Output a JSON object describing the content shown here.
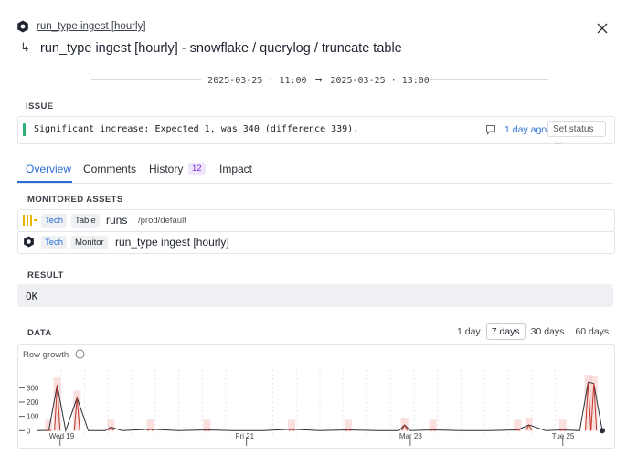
{
  "header": {
    "breadcrumb_link": "run_type ingest [hourly]",
    "subtitle": "run_type ingest [hourly] - snowflake / querylog / truncate table",
    "sub_arrow": "↳"
  },
  "time_range": {
    "start": "2025-03-25 · 11:00",
    "arrow": "→",
    "end": "2025-03-25 · 13:00"
  },
  "issue": {
    "section_label": "ISSUE",
    "message": "Significant increase: Expected 1, was 340 (difference 339).",
    "age": "1 day ago",
    "status_button": "Set status",
    "status_color": "#2fb077"
  },
  "tabs": [
    {
      "label": "Overview",
      "active": true
    },
    {
      "label": "Comments",
      "active": false
    },
    {
      "label": "History",
      "active": false,
      "badge": "12"
    },
    {
      "label": "Impact",
      "active": false
    }
  ],
  "monitored_assets": {
    "section_label": "MONITORED ASSETS",
    "items": [
      {
        "icon": "snowflake-table-icon",
        "tag1": "Tech",
        "tag2": "Table",
        "name": "runs",
        "path": "/prod/default"
      },
      {
        "icon": "monitor-icon",
        "tag1": "Tech",
        "tag2": "Monitor",
        "name": "run_type ingest [hourly]",
        "path": ""
      }
    ]
  },
  "result": {
    "section_label": "RESULT",
    "value": "OK"
  },
  "data": {
    "section_label": "DATA",
    "ranges": [
      {
        "label": "1 day",
        "selected": false
      },
      {
        "label": "7 days",
        "selected": true
      },
      {
        "label": "30 days",
        "selected": false
      },
      {
        "label": "60 days",
        "selected": false
      }
    ],
    "chart_title": "Row growth"
  },
  "chart_data": {
    "type": "line",
    "title": "Row growth",
    "y_ticks": [
      0,
      100,
      200,
      300
    ],
    "ylim": [
      -30,
      430
    ],
    "x_ticks": [
      "Wed 19",
      "Fri 21",
      "Mar 23",
      "Tue 25"
    ],
    "x_tick_positions": [
      0.04,
      0.37,
      0.66,
      0.93
    ],
    "series": [
      {
        "x": [
          0.0,
          0.02,
          0.035,
          0.05,
          0.07,
          0.09,
          0.12,
          0.13,
          0.15,
          0.2,
          0.25,
          0.3,
          0.35,
          0.4,
          0.45,
          0.5,
          0.55,
          0.6,
          0.64,
          0.65,
          0.66,
          0.7,
          0.75,
          0.8,
          0.85,
          0.87,
          0.9,
          0.93,
          0.96,
          0.975,
          0.985,
          1.0
        ],
        "y": [
          0,
          2,
          320,
          0,
          230,
          0,
          0,
          25,
          0,
          10,
          0,
          5,
          0,
          0,
          10,
          0,
          5,
          0,
          0,
          40,
          0,
          5,
          0,
          0,
          5,
          40,
          0,
          5,
          0,
          340,
          330,
          0
        ]
      }
    ],
    "highlight_color": "#f7c9c9",
    "line_color": "#2a2e36",
    "spike_color": "#c0392b"
  }
}
